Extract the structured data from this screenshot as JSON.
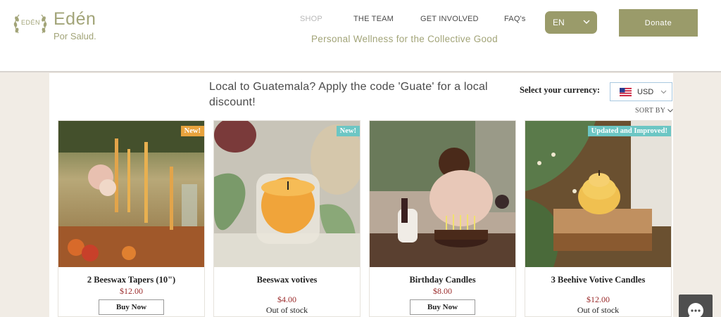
{
  "brand": {
    "badge_text": "EDÉN",
    "title": "Edén",
    "subtitle": "Por Salud."
  },
  "nav": [
    {
      "label": "SHOP",
      "active": true
    },
    {
      "label": "THE TEAM"
    },
    {
      "label": "GET INVOLVED"
    },
    {
      "label": "FAQ's"
    }
  ],
  "tagline": "Personal Wellness for the Collective Good",
  "language": {
    "selected": "EN"
  },
  "donate_label": "Donate",
  "promo_text": "Local to Guatemala? Apply the code 'Guate' for a local discount!",
  "currency": {
    "label": "Select your currency:",
    "selected": "USD"
  },
  "sort_label": "SORT BY",
  "products": [
    {
      "name": "2 Beeswax Tapers (10\")",
      "price": "$12.00",
      "badge": "New!",
      "action": "Buy Now"
    },
    {
      "name": "Beeswax votives",
      "price": "$4.00",
      "badge": "New!",
      "status": "Out of stock"
    },
    {
      "name": "Birthday Candles",
      "price": "$8.00",
      "action": "Buy Now"
    },
    {
      "name": "3 Beehive Votive Candles",
      "price": "$12.00",
      "badge": "Updated and Improved!",
      "status": "Out of stock"
    }
  ],
  "colors": {
    "accent": "#9a9b6a",
    "badge_orange": "#e8a33d",
    "badge_teal": "#6cc6c4",
    "price": "#9a2a2a"
  },
  "icons": {
    "chat": "chat-bubble-icon"
  }
}
